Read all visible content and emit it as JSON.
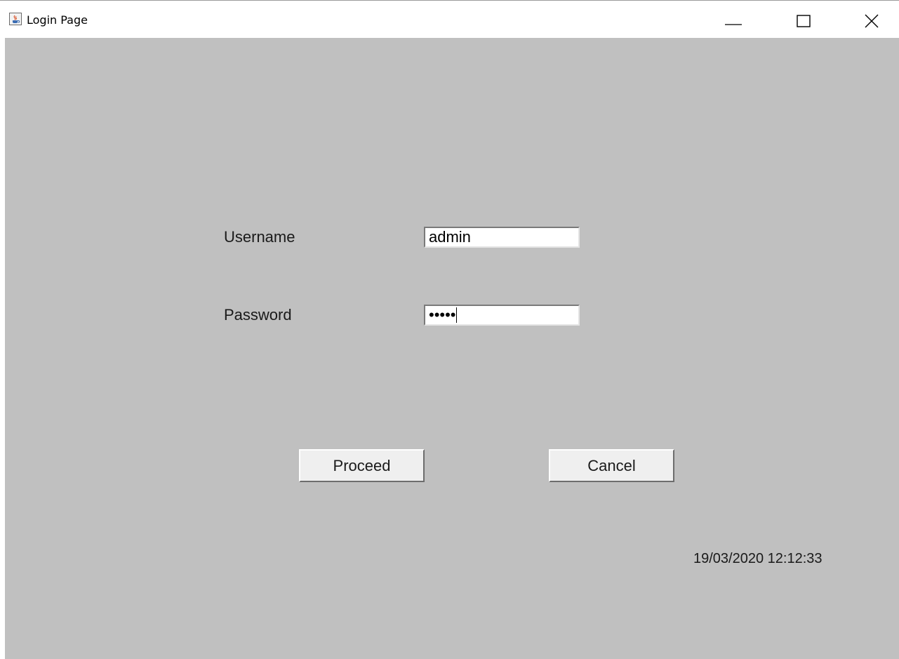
{
  "window": {
    "title": "Login Page",
    "icon": "java-cup-icon",
    "controls": [
      "minimize-icon",
      "maximize-icon",
      "close-icon"
    ]
  },
  "form": {
    "username_label": "Username",
    "username_value": "admin",
    "password_label": "Password",
    "password_masked": "•••••"
  },
  "buttons": {
    "proceed_label": "Proceed",
    "cancel_label": "Cancel"
  },
  "status": {
    "timestamp": "19/03/2020 12:12:33"
  },
  "colors": {
    "panel_background": "#c0c0c0",
    "button_background": "#efefef",
    "field_background": "#ffffff"
  }
}
